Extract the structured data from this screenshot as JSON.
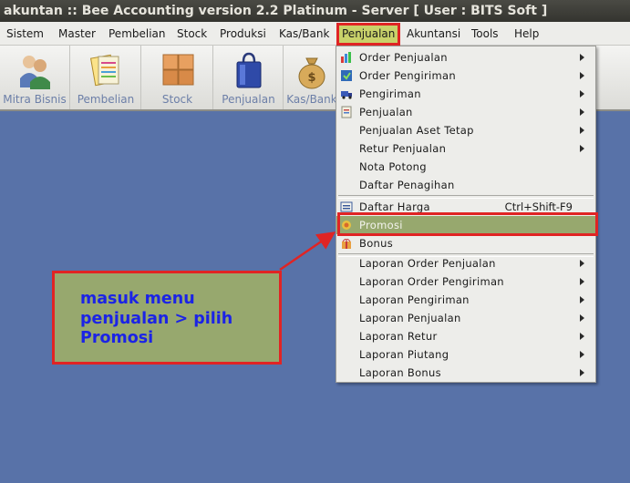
{
  "window": {
    "title": "akuntan :: Bee Accounting version 2.2 Platinum - Server  [ User : BITS Soft ]"
  },
  "menubar": {
    "items": [
      "Sistem",
      "Master",
      "Pembelian",
      "Stock",
      "Produksi",
      "Kas/Bank",
      "Penjualan",
      "Akuntansi",
      "Tools",
      "Help"
    ],
    "active": "Penjualan"
  },
  "toolbar": {
    "buttons": [
      {
        "label": "Mitra Bisnis",
        "icon": "people-icon"
      },
      {
        "label": "Pembelian",
        "icon": "documents-icon"
      },
      {
        "label": "Stock",
        "icon": "boxes-icon"
      },
      {
        "label": "Penjualan",
        "icon": "shopping-bag-icon"
      },
      {
        "label": "Kas/Bank",
        "icon": "money-bag-icon"
      }
    ]
  },
  "dropdown": {
    "group1": [
      {
        "label": "Order Penjualan",
        "icon": "order-chart-icon",
        "submenu": true
      },
      {
        "label": "Order Pengiriman",
        "icon": "order-ship-icon",
        "submenu": true
      },
      {
        "label": "Pengiriman",
        "icon": "truck-icon",
        "submenu": true
      },
      {
        "label": "Penjualan",
        "icon": "invoice-icon",
        "submenu": true
      },
      {
        "label": "Penjualan Aset Tetap",
        "icon": "",
        "submenu": true
      },
      {
        "label": "Retur Penjualan",
        "icon": "",
        "submenu": true
      },
      {
        "label": "Nota Potong",
        "icon": "",
        "submenu": false
      },
      {
        "label": "Daftar Penagihan",
        "icon": "",
        "submenu": false
      }
    ],
    "group2": [
      {
        "label": "Daftar Harga",
        "icon": "price-list-icon",
        "shortcut": "Ctrl+Shift-F9"
      },
      {
        "label": "Promosi",
        "icon": "promo-icon",
        "highlighted": true
      },
      {
        "label": "Bonus",
        "icon": "gift-icon"
      }
    ],
    "group3": [
      {
        "label": "Laporan Order Penjualan",
        "submenu": true
      },
      {
        "label": "Laporan Order Pengiriman",
        "submenu": true
      },
      {
        "label": "Laporan Pengiriman",
        "submenu": true
      },
      {
        "label": "Laporan Penjualan",
        "submenu": true
      },
      {
        "label": "Laporan Retur",
        "submenu": true
      },
      {
        "label": "Laporan Piutang",
        "submenu": true
      },
      {
        "label": "Laporan Bonus",
        "submenu": true
      }
    ]
  },
  "callout": {
    "lines": [
      "masuk menu",
      "penjualan > pilih",
      "Promosi"
    ]
  },
  "colors": {
    "desktop": "#5872a8",
    "highlight": "#97a86e",
    "annotation_red": "#e02424",
    "callout_text": "#1b23e6"
  }
}
